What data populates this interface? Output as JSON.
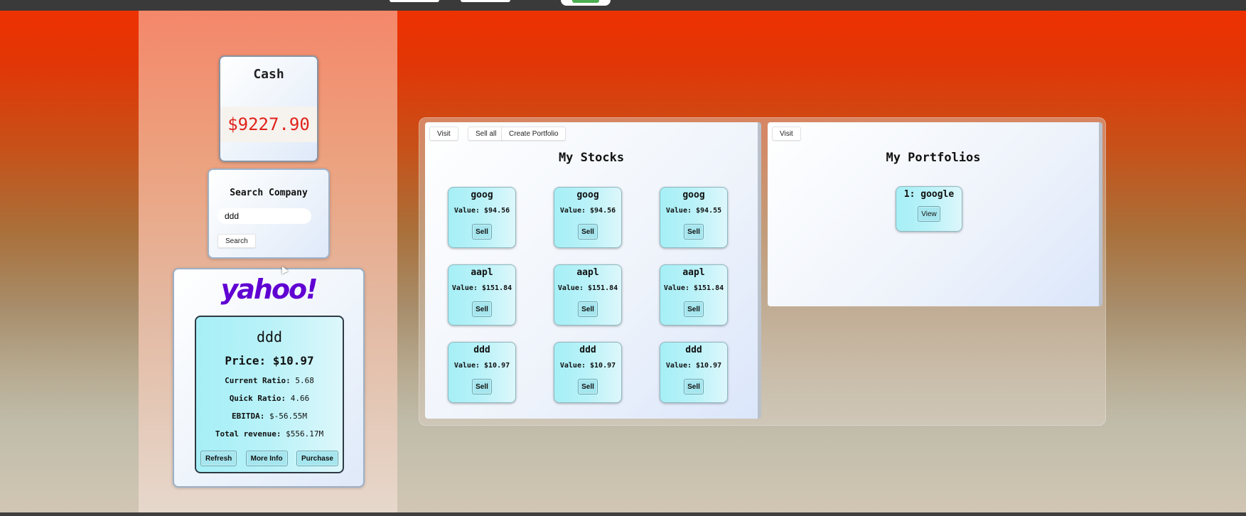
{
  "cash": {
    "title": "Cash",
    "amount": "$9227.90"
  },
  "search": {
    "title": "Search Company",
    "input_value": "ddd",
    "button_label": "Search"
  },
  "yahoo": {
    "logo_text": "yahoo!",
    "stock": {
      "name": "ddd",
      "price": "Price: $10.97",
      "metrics": [
        {
          "label": "Current Ratio:",
          "value": "5.68"
        },
        {
          "label": "Quick Ratio:",
          "value": "4.66"
        },
        {
          "label": "EBITDA:",
          "value": "$-56.55M"
        },
        {
          "label": "Total revenue:",
          "value": "$556.17M"
        }
      ],
      "actions": {
        "refresh": "Refresh",
        "more_info": "More Info",
        "purchase": "Purchase"
      }
    }
  },
  "stocks_panel": {
    "title": "My Stocks",
    "toolbar": {
      "visit": "Visit",
      "sell_all": "Sell all",
      "create_portfolio": "Create Portfolio"
    },
    "items": [
      {
        "name": "goog",
        "value": "Value: $94.56",
        "sell": "Sell"
      },
      {
        "name": "goog",
        "value": "Value: $94.56",
        "sell": "Sell"
      },
      {
        "name": "goog",
        "value": "Value: $94.55",
        "sell": "Sell"
      },
      {
        "name": "aapl",
        "value": "Value: $151.84",
        "sell": "Sell"
      },
      {
        "name": "aapl",
        "value": "Value: $151.84",
        "sell": "Sell"
      },
      {
        "name": "aapl",
        "value": "Value: $151.84",
        "sell": "Sell"
      },
      {
        "name": "ddd",
        "value": "Value: $10.97",
        "sell": "Sell"
      },
      {
        "name": "ddd",
        "value": "Value: $10.97",
        "sell": "Sell"
      },
      {
        "name": "ddd",
        "value": "Value: $10.97",
        "sell": "Sell"
      }
    ]
  },
  "portfolios_panel": {
    "title": "My Portfolios",
    "toolbar": {
      "visit": "Visit"
    },
    "items": [
      {
        "name": "1: google",
        "view": "View"
      }
    ]
  },
  "colors": {
    "accent_red": "#e0221a",
    "card_cyan": "#a6eff6",
    "yahoo_purple": "#6001d2"
  }
}
